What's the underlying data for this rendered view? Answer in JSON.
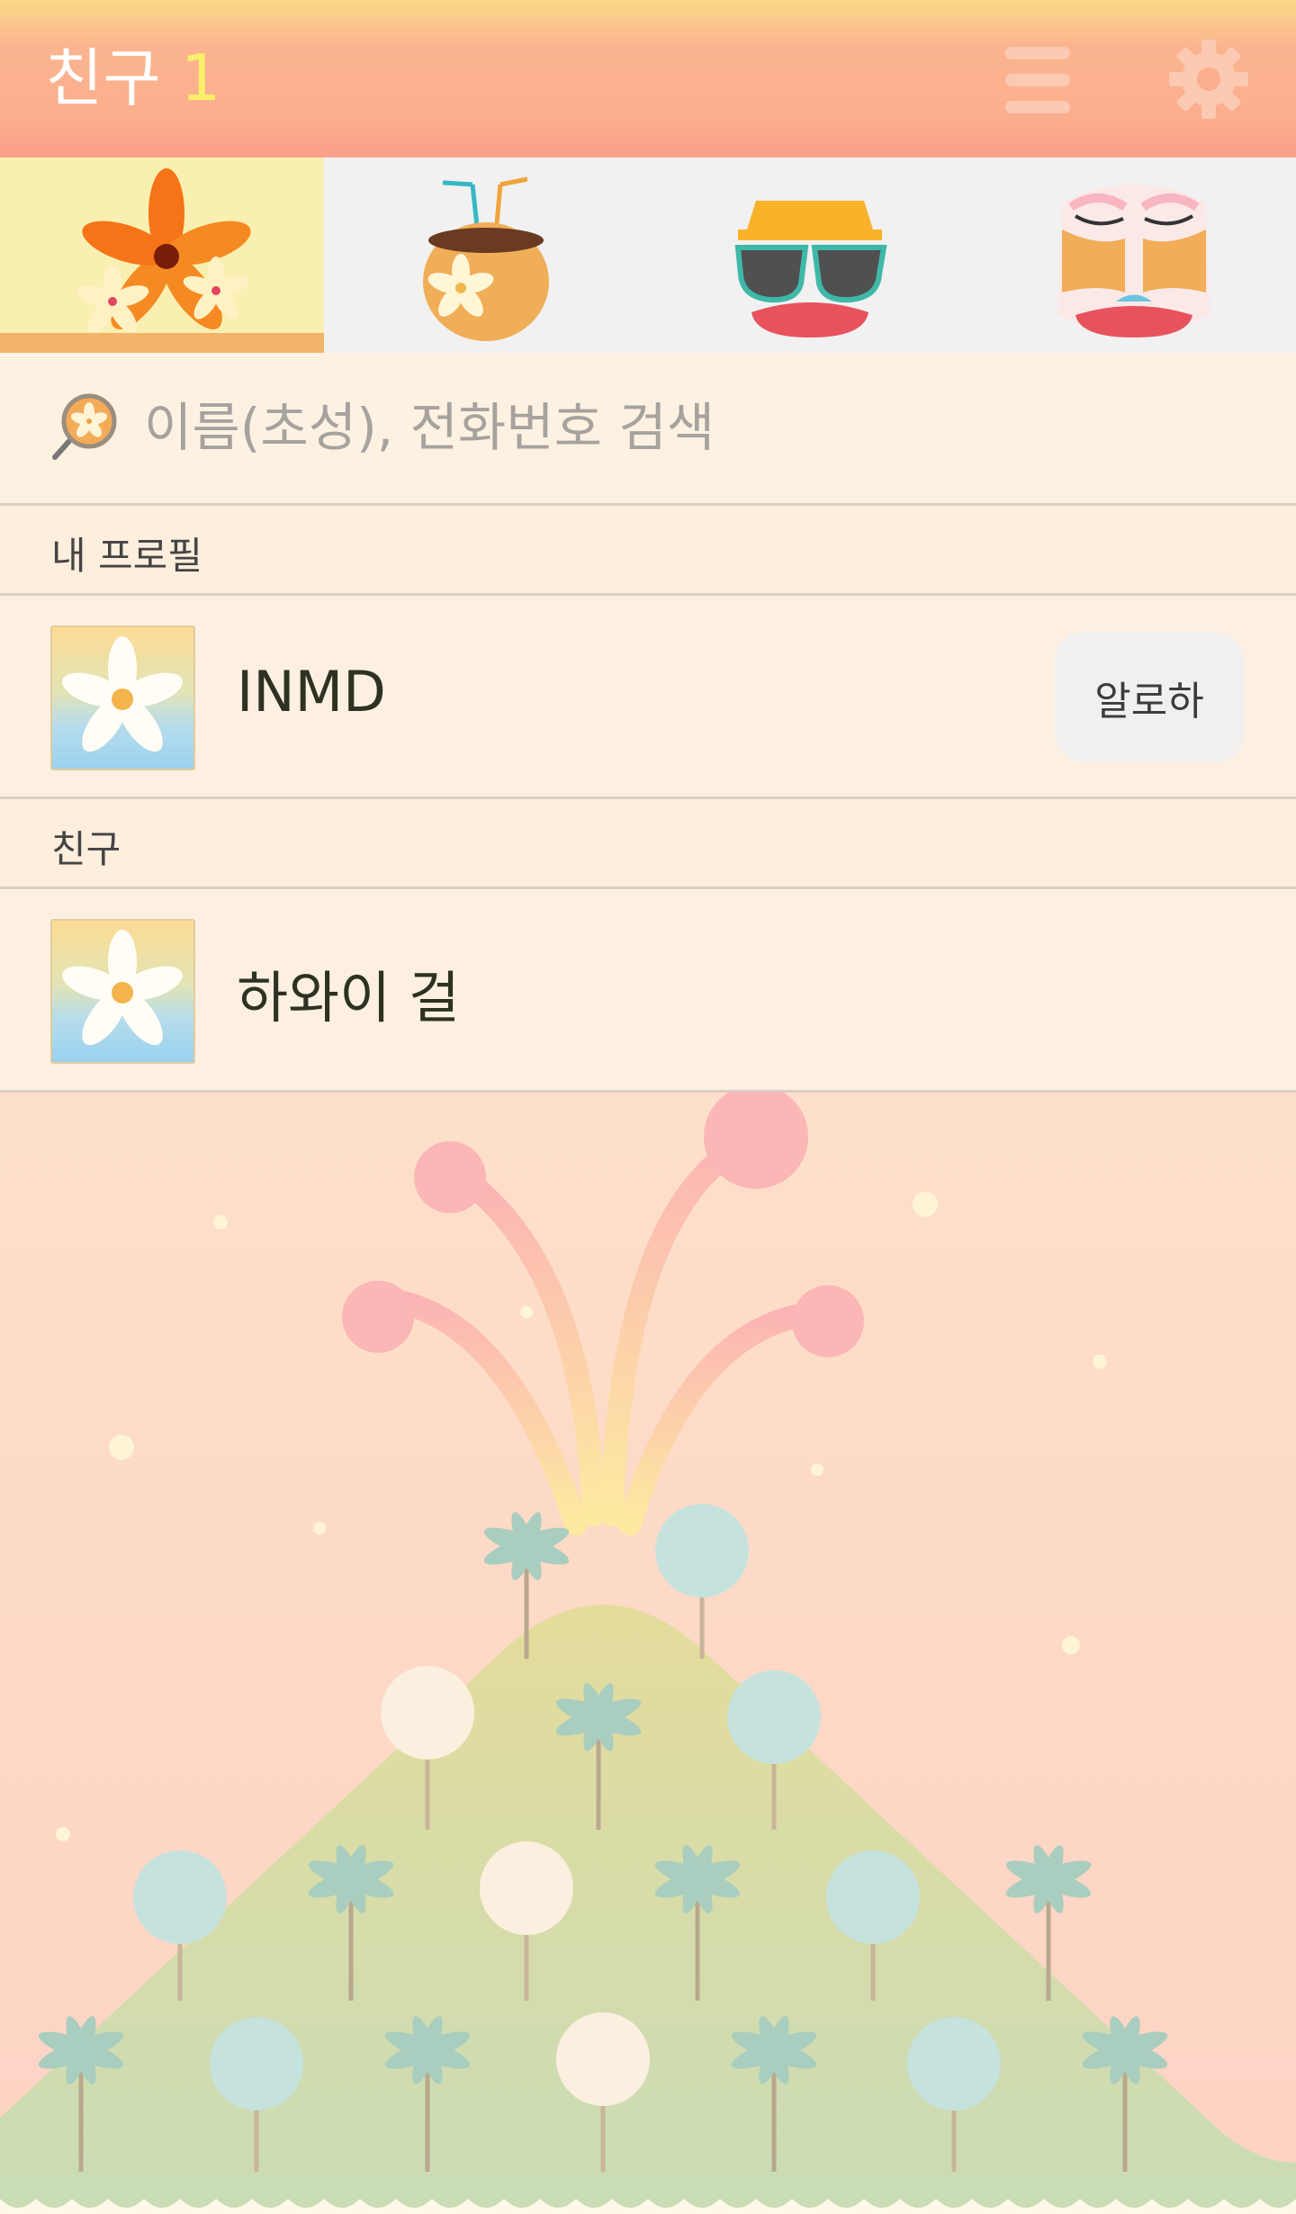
{
  "header": {
    "title": "친구",
    "count": "1",
    "menu_icon": "hamburger-menu-icon",
    "settings_icon": "gear-icon"
  },
  "tabs": [
    {
      "icon": "tropical-flower-icon",
      "selected": true
    },
    {
      "icon": "coconut-drink-icon",
      "selected": false
    },
    {
      "icon": "sunglasses-face-icon",
      "selected": false
    },
    {
      "icon": "sleeping-face-icon",
      "selected": false
    }
  ],
  "search": {
    "placeholder": "이름(초성), 전화번호 검색",
    "icon": "flower-search-icon"
  },
  "my_profile": {
    "section_label": "내 프로필",
    "name": "INMD",
    "action_label": "알로하"
  },
  "friends": {
    "section_label": "친구",
    "items": [
      {
        "name": "하와이 걸"
      }
    ]
  },
  "colors": {
    "header_top": "#fbd889",
    "header_main": "#fbae8d",
    "count": "#f9f06a",
    "tab_active_bg": "#f9efb1",
    "tab_indicator": "#f3b369"
  }
}
